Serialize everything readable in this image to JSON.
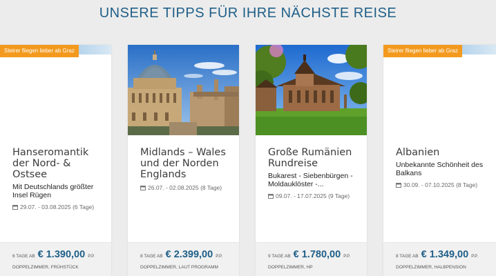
{
  "heading": "UNSERE TIPPS FÜR IHRE NÄCHSTE REISE",
  "colors": {
    "accent": "#1f5f88",
    "badge": "#f39a1e"
  },
  "cards": [
    {
      "badge": "Steirer fliegen lieber ab Graz",
      "image": "none",
      "title": "Hanseromantik der Nord- & Ostsee",
      "subtitle": "Mit Deutschlands größter Insel Rügen",
      "date": "29.07. - 03.08.2025 (6 Tage)",
      "tage_label": "6 TAGE AB",
      "price": "€ 1.390,00",
      "pp": "P.P.",
      "board": "DOPPELZIMMER, FRÜHSTÜCK"
    },
    {
      "badge": "",
      "image": "oxford-radcliffe-camera-photo",
      "title": "Midlands – Wales und der Norden Englands",
      "subtitle": "",
      "date": "26.07. - 02.08.2025 (8 Tage)",
      "tage_label": "8 TAGE AB",
      "price": "€ 2.399,00",
      "pp": "P.P.",
      "board": "DOPPELZIMMER, LAUT PROGRAMM"
    },
    {
      "badge": "",
      "image": "romanian-monastery-photo",
      "title": "Große Rumänien Rundreise",
      "subtitle": "Bukarest - Siebenbürgen - Moldauklöster -...",
      "date": "09.07. - 17.07.2025 (9 Tage)",
      "tage_label": "9 TAGE AB",
      "price": "€ 1.780,00",
      "pp": "P.P.",
      "board": "DOPPELZIMMER, HP"
    },
    {
      "badge": "Steirer fliegen lieber ab Graz",
      "image": "none",
      "title": "Albanien",
      "subtitle": "Unbekannte Schönheit des Balkans",
      "date": "30.09. - 07.10.2025 (8 Tage)",
      "tage_label": "8 TAGE AB",
      "price": "€ 1.349,00",
      "pp": "P.P.",
      "board": "DOPPELZIMMER, HALBPENSION"
    }
  ]
}
